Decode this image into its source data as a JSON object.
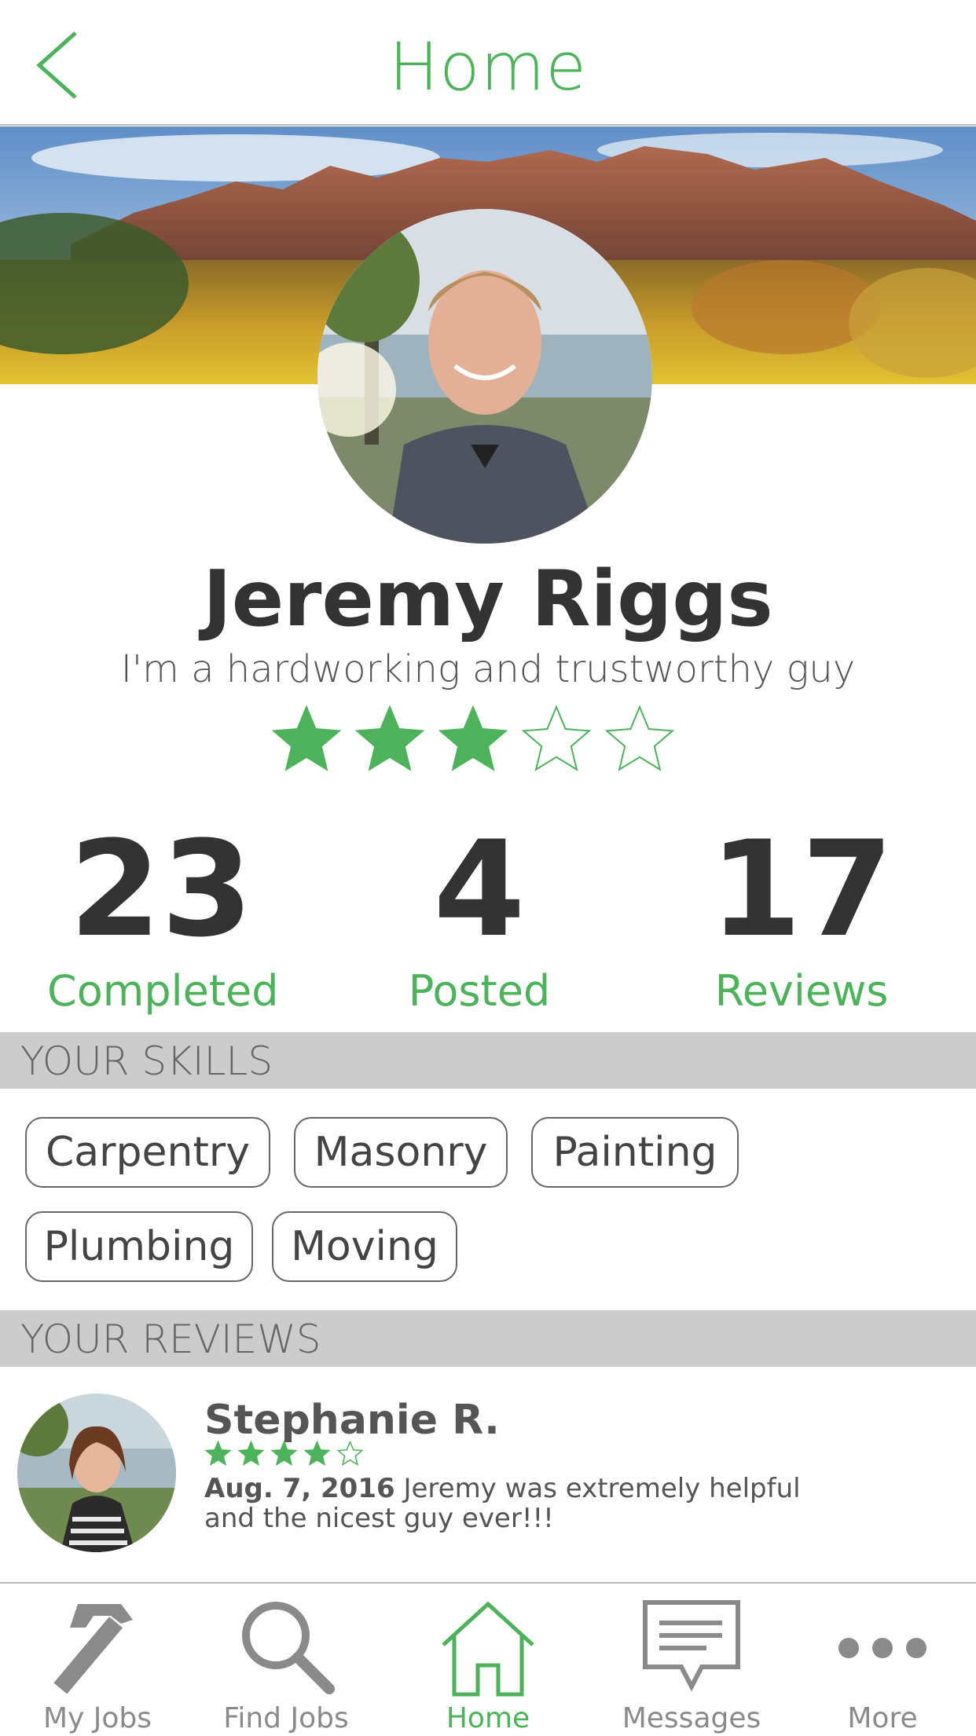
{
  "header": {
    "title": "Home",
    "back_icon": "chevron-left-icon"
  },
  "profile": {
    "name": "Jeremy Riggs",
    "tagline": "I'm a hardworking and trustworthy guy",
    "rating": 3,
    "rating_max": 5
  },
  "stats": [
    {
      "value": "23",
      "label": "Completed"
    },
    {
      "value": "4",
      "label": "Posted"
    },
    {
      "value": "17",
      "label": "Reviews"
    }
  ],
  "skills": {
    "heading": "YOUR SKILLS",
    "items": [
      "Carpentry",
      "Masonry",
      "Painting",
      "Plumbing",
      "Moving"
    ]
  },
  "reviews": {
    "heading": "YOUR REVIEWS",
    "items": [
      {
        "reviewer": "Stephanie R.",
        "rating": 4,
        "rating_max": 5,
        "date": "Aug. 7, 2016",
        "text": "Jeremy was extremely helpful and the nicest guy ever!!!"
      }
    ]
  },
  "tabbar": {
    "items": [
      {
        "label": "My Jobs",
        "icon": "hammer-icon",
        "active": false
      },
      {
        "label": "Find Jobs",
        "icon": "magnifier-icon",
        "active": false
      },
      {
        "label": "Home",
        "icon": "house-icon",
        "active": true
      },
      {
        "label": "Messages",
        "icon": "speech-bubble-icon",
        "active": false
      },
      {
        "label": "More",
        "icon": "ellipsis-icon",
        "active": false
      }
    ]
  },
  "colors": {
    "accent": "#4db35a",
    "section_bg": "#cccccc",
    "text_dark": "#333333"
  }
}
